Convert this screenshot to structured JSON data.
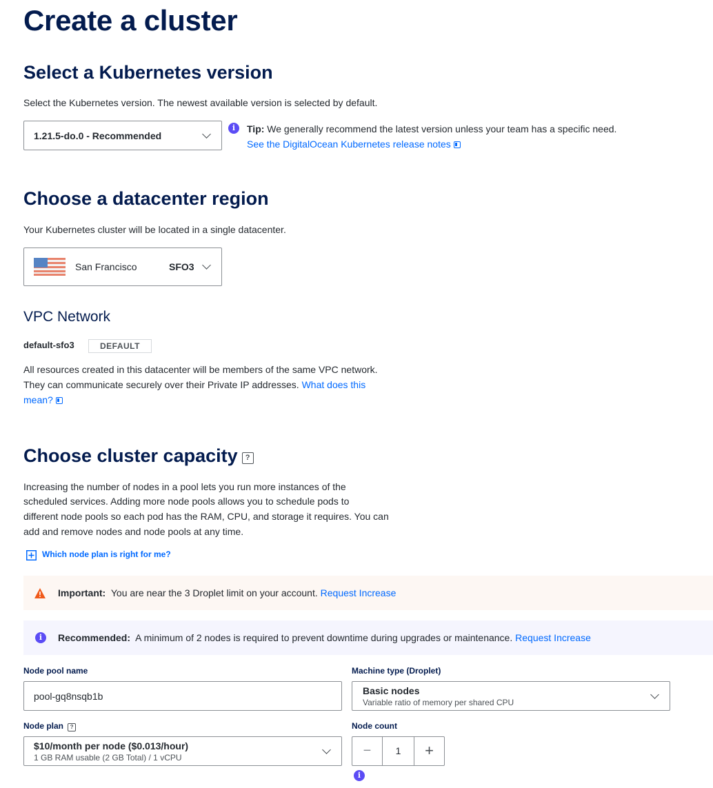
{
  "page": {
    "title": "Create a cluster"
  },
  "k8s": {
    "heading": "Select a Kubernetes version",
    "description": "Select the Kubernetes version. The newest available version is selected by default.",
    "selected_version": "1.21.5-do.0 - Recommended",
    "tip_label": "Tip:",
    "tip_text": "We generally recommend the latest version unless your team has a specific need.",
    "release_notes_link": "See the DigitalOcean Kubernetes release notes"
  },
  "region": {
    "heading": "Choose a datacenter region",
    "description": "Your Kubernetes cluster will be located in a single datacenter.",
    "city": "San Francisco",
    "code": "SFO3"
  },
  "vpc": {
    "heading": "VPC Network",
    "name": "default-sfo3",
    "badge": "DEFAULT",
    "description_line1": "All resources created in this datacenter will be members of the same VPC network.",
    "description_line2": "They can communicate securely over their Private IP addresses.",
    "link_part1": "What does this",
    "link_part2": "mean?"
  },
  "capacity": {
    "heading": "Choose cluster capacity",
    "help_glyph": "?",
    "line1": "Increasing the number of nodes in a pool lets you run more instances of the",
    "line2": "scheduled services. Adding more node pools allows you to schedule pods to",
    "line3": "different node pools so each pod has the RAM, CPU, and storage it requires. You can",
    "line4": "add and remove nodes and node pools at any time.",
    "plan_help_link": "Which node plan is right for me?"
  },
  "alerts": {
    "important_label": "Important:",
    "important_text": "You are near the 3 Droplet limit on your account.",
    "important_link": "Request Increase",
    "recommended_label": "Recommended:",
    "recommended_text": "A minimum of 2 nodes is required to prevent downtime during upgrades or maintenance.",
    "recommended_link": "Request Increase"
  },
  "node_pool": {
    "name_label": "Node pool name",
    "name_value": "pool-gq8nsqb1b",
    "machine_label": "Machine type (Droplet)",
    "machine_title": "Basic nodes",
    "machine_sub": "Variable ratio of memory per shared CPU",
    "plan_label": "Node plan",
    "plan_help_glyph": "?",
    "plan_title": "$10/month per node ($0.013/hour)",
    "plan_sub": "1 GB RAM usable (2 GB Total) / 1 vCPU",
    "count_label": "Node count",
    "count_value": "1",
    "minus_glyph": "−",
    "plus_glyph": "+",
    "info_glyph": "i"
  },
  "colors": {
    "heading": "#031b4e",
    "link": "#0069ff",
    "info": "#5b4cf5",
    "warning": "#f05a1a",
    "warning_bg": "#fdf7f3",
    "info_bg": "#f5f5fe"
  }
}
